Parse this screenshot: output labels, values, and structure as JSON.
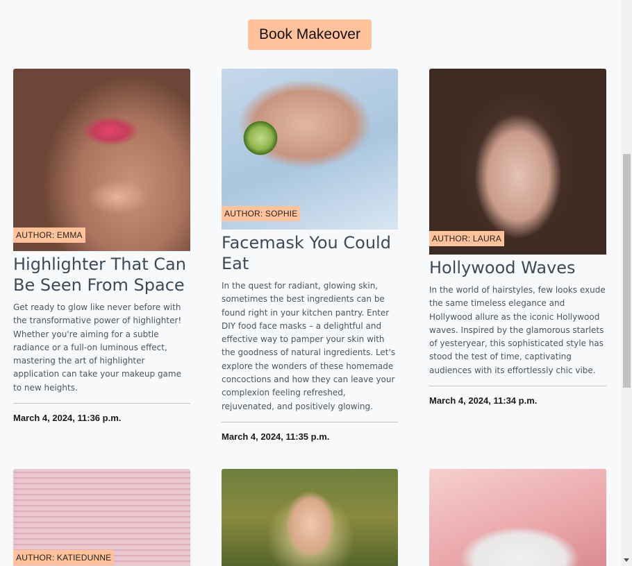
{
  "cta": {
    "label": "Book Makeover"
  },
  "posts": [
    {
      "author": "AUTHOR: EMMA",
      "title": "Highlighter That Can Be Seen From Space",
      "excerpt": "Get ready to glow like never before with the transformative power of highlighter! Whether you're aiming for a subtle radiance or a full-on luminous effect, mastering the art of highlighter application can take your makeup game to new heights.",
      "date": "March 4, 2024, 11:36 p.m."
    },
    {
      "author": "AUTHOR: SOPHIE",
      "title": "Facemask You Could Eat",
      "excerpt": "In the quest for radiant, glowing skin, sometimes the best ingredients can be found right in your kitchen pantry. Enter DIY food face masks – a delightful and effective way to pamper your skin with the goodness of natural ingredients. Let's explore the wonders of these homemade concoctions and how they can leave your complexion feeling refreshed, rejuvenated, and positively glowing.",
      "date": "March 4, 2024, 11:35 p.m."
    },
    {
      "author": "AUTHOR: LAURA",
      "title": "Hollywood Waves",
      "excerpt": "In the world of hairstyles, few looks exude the same timeless elegance and Hollywood allure as the iconic Hollywood waves. Inspired by the glamorous starlets of yesteryear, this sophisticated style has stood the test of time, captivating audiences with its effortlessly chic vibe.",
      "date": "March 4, 2024, 11:34 p.m."
    },
    {
      "author": "AUTHOR: KATIEDUNNE"
    }
  ]
}
